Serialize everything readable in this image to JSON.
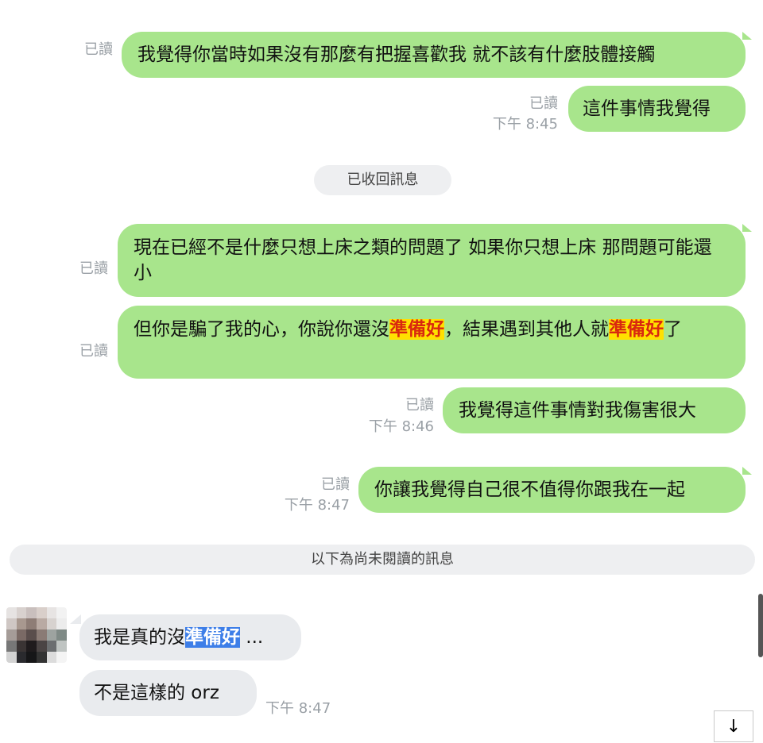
{
  "messages": [
    {
      "read": "已讀",
      "text": "我覺得你當時如果沒有那麼有把握喜歡我 就不該有什麼肢體接觸"
    },
    {
      "read": "已讀",
      "time": "下午 8:45",
      "text": "這件事情我覺得"
    },
    {
      "read": "已讀",
      "text": "現在已經不是什麼只想上床之類的問題了 如果你只想上床 那問題可能還小"
    },
    {
      "read": "已讀",
      "text_parts": [
        "但你是騙了我的心，你說你還沒",
        "準備好",
        "，結果遇到其他人就",
        "準備好",
        "了"
      ]
    },
    {
      "read": "已讀",
      "time": "下午 8:46",
      "text": "我覺得這件事情對我傷害很大"
    },
    {
      "read": "已讀",
      "time": "下午 8:47",
      "text": "你讓我覺得自己很不值得你跟我在一起"
    }
  ],
  "system": {
    "recalled": "已收回訊息",
    "unread_divider": "以下為尚未閱讀的訊息"
  },
  "incoming": [
    {
      "text_parts": [
        "我是真的沒",
        "準備好",
        " ..."
      ]
    },
    {
      "text": "不是這樣的 orz",
      "time": "下午 8:47"
    }
  ],
  "controls": {
    "scroll_down_icon": "↓"
  },
  "colors": {
    "outgoing_bubble": "#a8e58c",
    "incoming_bubble": "#e9ebee",
    "highlight_orange": "#ffe000",
    "highlight_blue": "#3d7ee8"
  }
}
